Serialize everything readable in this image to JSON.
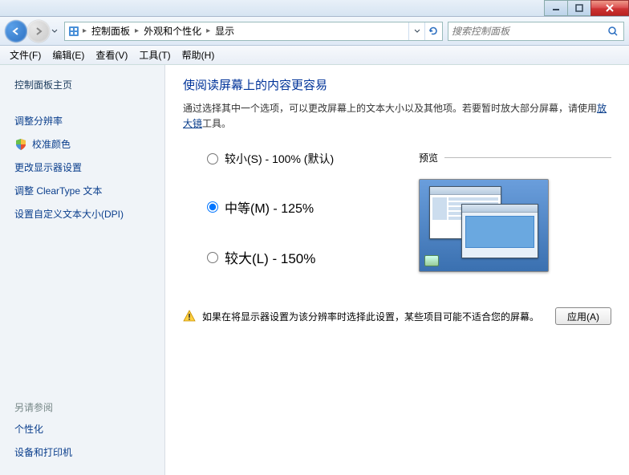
{
  "titlebar": {},
  "navbar": {
    "crumbs": [
      "控制面板",
      "外观和个性化",
      "显示"
    ],
    "search_placeholder": "搜索控制面板"
  },
  "menubar": {
    "items": [
      "文件(F)",
      "编辑(E)",
      "查看(V)",
      "工具(T)",
      "帮助(H)"
    ]
  },
  "sidebar": {
    "home": "控制面板主页",
    "links": [
      "调整分辨率",
      "校准颜色",
      "更改显示器设置",
      "调整 ClearType 文本",
      "设置自定义文本大小(DPI)"
    ],
    "see_also_heading": "另请参阅",
    "see_also": [
      "个性化",
      "设备和打印机"
    ]
  },
  "content": {
    "title": "使阅读屏幕上的内容更容易",
    "desc_before_link": "通过选择其中一个选项，可以更改屏幕上的文本大小以及其他项。若要暂时放大部分屏幕，请使用",
    "magnifier_link": "放大镜",
    "desc_after_link": "工具。",
    "options": [
      {
        "label": "较小(S) - 100% (默认)",
        "value": "small",
        "checked": false
      },
      {
        "label": "中等(M) - 125%",
        "value": "medium",
        "checked": true
      },
      {
        "label": "较大(L) - 150%",
        "value": "large",
        "checked": false
      }
    ],
    "preview_label": "预览",
    "warning": "如果在将显示器设置为该分辨率时选择此设置，某些项目可能不适合您的屏幕。",
    "apply_label": "应用(A)"
  }
}
